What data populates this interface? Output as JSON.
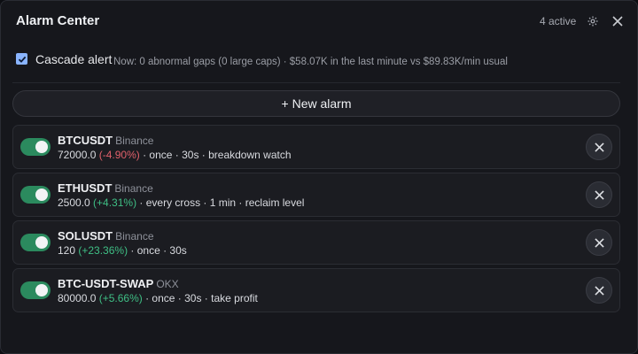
{
  "header": {
    "title": "Alarm Center",
    "active_count": "4 active",
    "settings_icon": "gear-icon",
    "close_icon": "close-icon"
  },
  "cascade": {
    "checked": true,
    "label": "Cascade alert",
    "status": "Now: 0 abnormal gaps (0 large caps) · $58.07K in the last minute vs $89.83K/min usual"
  },
  "new_alarm_label": "+ New alarm",
  "colors": {
    "accent_checkbox": "#8ab4ff",
    "toggle_on": "#2b8a5e",
    "negative": "#e0606a",
    "positive": "#3fbf85"
  },
  "alarms": [
    {
      "enabled": true,
      "symbol": "BTCUSDT",
      "exchange": "Binance",
      "price": "72000.0",
      "change": "(-4.90%)",
      "direction": "negative",
      "rest": " · once · 30s · breakdown watch"
    },
    {
      "enabled": true,
      "symbol": "ETHUSDT",
      "exchange": "Binance",
      "price": "2500.0",
      "change": "(+4.31%)",
      "direction": "positive",
      "rest": " · every cross · 1 min · reclaim level"
    },
    {
      "enabled": true,
      "symbol": "SOLUSDT",
      "exchange": "Binance",
      "price": "120",
      "change": "(+23.36%)",
      "direction": "positive",
      "rest": " · once · 30s"
    },
    {
      "enabled": true,
      "symbol": "BTC-USDT-SWAP",
      "exchange": "OKX",
      "price": "80000.0",
      "change": "(+5.66%)",
      "direction": "positive",
      "rest": " · once · 30s · take profit"
    }
  ]
}
